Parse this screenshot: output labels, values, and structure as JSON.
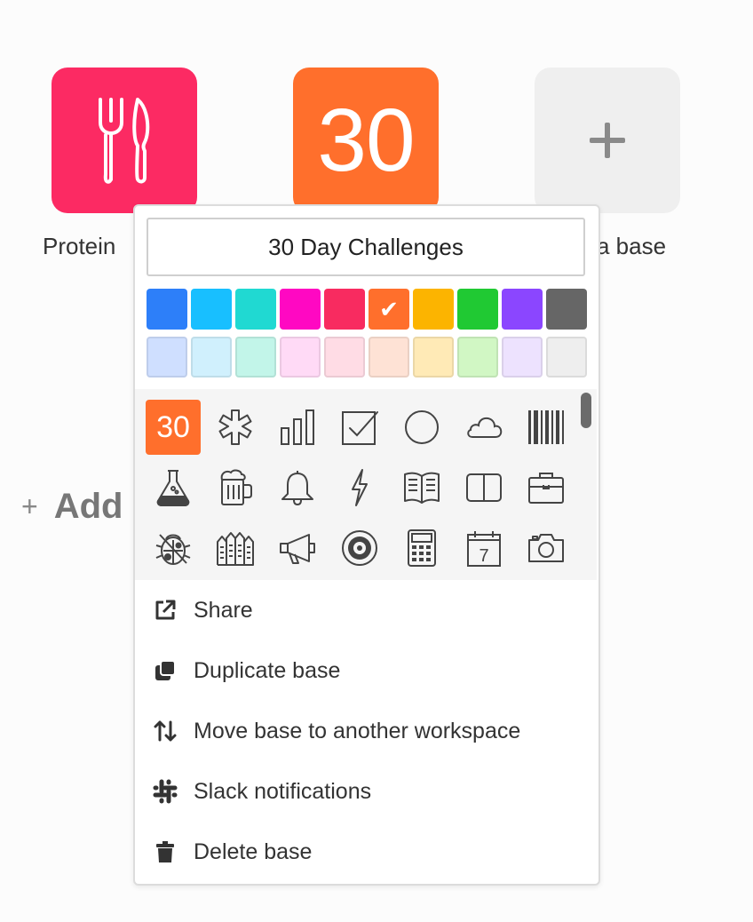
{
  "tiles": {
    "protein": {
      "label": "Protein",
      "color": "#fc2a63",
      "icon": "fork-knife-icon"
    },
    "challenge": {
      "number": "30",
      "color": "#ff6f2c"
    },
    "add": {
      "label": "a base",
      "icon": "plus-icon"
    }
  },
  "add_workspace": {
    "plus": "+",
    "label": "Add"
  },
  "popover": {
    "name_value": "30 Day Challenges",
    "colors": {
      "selected": "#ff6f2c",
      "saturated": [
        "#2d7ff9",
        "#18bfff",
        "#20d9d2",
        "#ff08c2",
        "#f82b60",
        "#ff6f2c",
        "#fcb400",
        "#20c933",
        "#8b46ff",
        "#666666"
      ],
      "light": [
        "#cfdfff",
        "#d0f0fd",
        "#c2f5e9",
        "#ffdaf6",
        "#ffdce5",
        "#fee2d5",
        "#ffeab6",
        "#d1f7c4",
        "#ede2fe",
        "#eeeeee"
      ]
    },
    "icons": {
      "selected_label": "30",
      "row1": [
        "number-30-icon",
        "asterisk-icon",
        "bar-chart-icon",
        "checkbox-icon",
        "circle-icon",
        "cloud-icon",
        "barcode-icon"
      ],
      "row2": [
        "flask-icon",
        "beer-mug-icon",
        "bell-icon",
        "lightning-icon",
        "open-book-icon",
        "book-icon",
        "briefcase-icon"
      ],
      "row3": [
        "bug-icon",
        "buildings-icon",
        "megaphone-icon",
        "target-icon",
        "calculator-icon",
        "calendar-icon",
        "camera-icon"
      ],
      "calendar_day": "7"
    },
    "menu": [
      {
        "label": "Share",
        "icon": "share-icon"
      },
      {
        "label": "Duplicate base",
        "icon": "duplicate-icon"
      },
      {
        "label": "Move base to another workspace",
        "icon": "move-icon"
      },
      {
        "label": "Slack notifications",
        "icon": "slack-icon"
      },
      {
        "label": "Delete base",
        "icon": "trash-icon"
      }
    ]
  }
}
